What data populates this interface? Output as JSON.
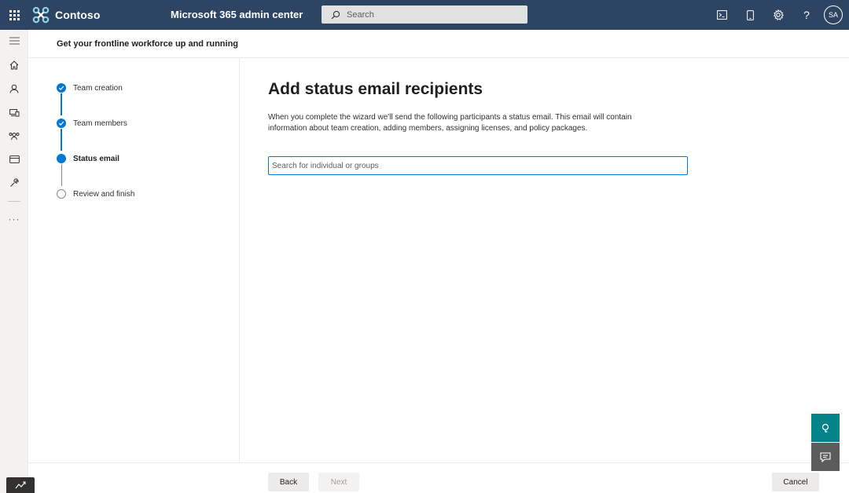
{
  "topbar": {
    "brand": "Contoso",
    "app_title": "Microsoft 365 admin center",
    "search_placeholder": "Search",
    "avatar_initials": "SA",
    "icons": [
      "app-launcher-icon",
      "terminal-icon",
      "mobile-icon",
      "gear-icon",
      "help-icon"
    ]
  },
  "rail": {
    "icons": [
      "hamburger-icon",
      "home-icon",
      "user-icon",
      "devices-icon",
      "teams-icon",
      "billing-icon",
      "wrench-icon",
      "more-icon"
    ],
    "more_label": "···"
  },
  "header": {
    "title": "Get your frontline workforce up and running"
  },
  "steps": [
    {
      "label": "Team creation",
      "state": "done"
    },
    {
      "label": "Team members",
      "state": "done"
    },
    {
      "label": "Status email",
      "state": "current"
    },
    {
      "label": "Review and finish",
      "state": "todo"
    }
  ],
  "main": {
    "title": "Add status email recipients",
    "description": "When you complete the wizard we'll send the following participants a status email. This email will contain information about team creation, adding members, assigning licenses, and policy packages.",
    "search_placeholder": "Search for individual or groups",
    "search_value": ""
  },
  "footer": {
    "back_label": "Back",
    "next_label": "Next",
    "cancel_label": "Cancel"
  },
  "colors": {
    "topbar": "#2d4563",
    "accent": "#0078d4",
    "help_fab": "#038387",
    "feedback_fab": "#5c5c5c"
  }
}
